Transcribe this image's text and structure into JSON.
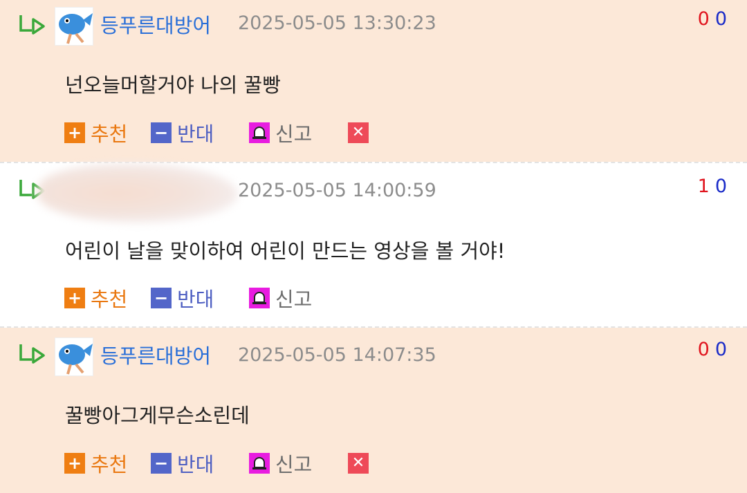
{
  "comments": [
    {
      "nickname": "등푸른대방어",
      "date": "2025-05-05 13:30:23",
      "up": "0",
      "down": "0",
      "text": "넌오늘머할거야 나의 꿀빵"
    },
    {
      "nickname": "",
      "date": "2025-05-05 14:00:59",
      "up": "1",
      "down": "0",
      "text": "어린이 날을 맞이하여 어린이 만드는 영상을 볼 거야!"
    },
    {
      "nickname": "등푸른대방어",
      "date": "2025-05-05 14:07:35",
      "up": "0",
      "down": "0",
      "text": "꿀빵아그게무슨소린데"
    }
  ],
  "actions": {
    "recommend": "추천",
    "oppose": "반대",
    "report": "신고"
  },
  "icons": {
    "reply": "reply-arrow-icon",
    "plus": "plus-icon",
    "minus": "minus-icon",
    "report": "siren-icon",
    "delete": "close-icon"
  },
  "colors": {
    "peach_bg": "#fce8d8",
    "nickname": "#2a6fd8",
    "recommend": "#ef7e12",
    "oppose": "#5366c9",
    "report_icon": "#e81ce0",
    "delete_icon": "#ee4a58",
    "vote_up": "#e0141e",
    "vote_down": "#1a2bc8"
  }
}
